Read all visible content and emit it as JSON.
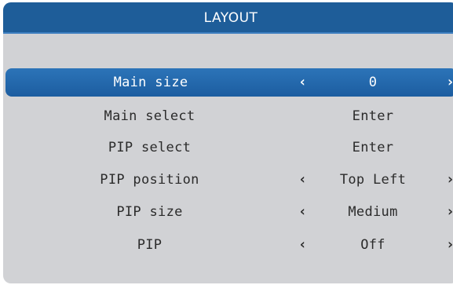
{
  "menu": {
    "title": "LAYOUT",
    "rows": [
      {
        "label": "Main size",
        "value": "0",
        "has_arrows": true,
        "selected": true
      },
      {
        "label": "Main select",
        "value": "Enter",
        "has_arrows": false
      },
      {
        "label": "PIP select",
        "value": "Enter",
        "has_arrows": false
      },
      {
        "label": "PIP position",
        "value": "Top Left",
        "has_arrows": true
      },
      {
        "label": "PIP size",
        "value": "Medium",
        "has_arrows": true
      },
      {
        "label": "PIP",
        "value": "Off",
        "has_arrows": true
      }
    ],
    "arrow_left_glyph": "‹",
    "arrow_right_glyph": "›"
  },
  "colors": {
    "panel_bg": "#d1d2d5",
    "title_bg": "#1e5d99",
    "selected_bg": "#2271b5",
    "text": "#2b2b2b",
    "selected_text": "#ffffff"
  }
}
